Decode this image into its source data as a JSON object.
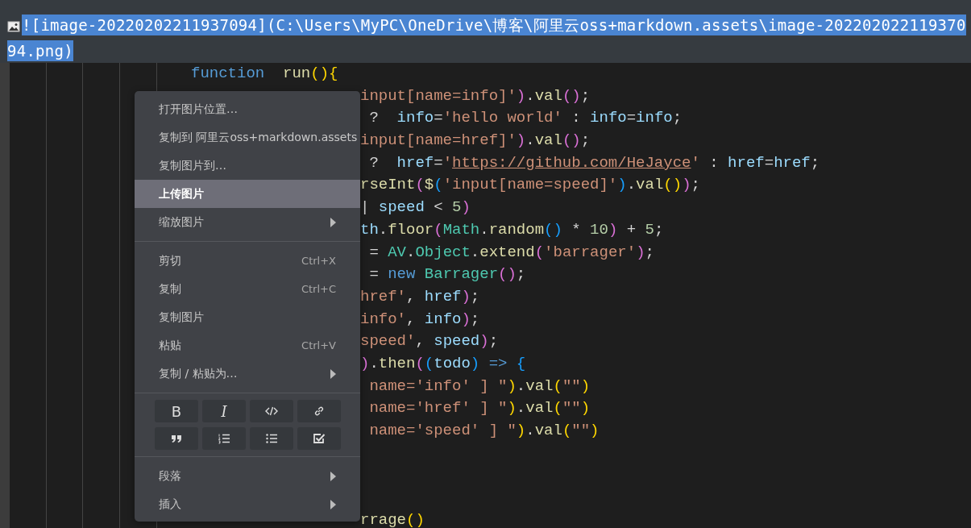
{
  "editor": {
    "image_line": {
      "text": "![image-20220202211937094](C:\\Users\\MyPC\\OneDrive\\博客\\阿里云oss+markdown.assets\\image-20220202211937094.png)",
      "selected": true
    },
    "code_lines": [
      {
        "kind": "full",
        "tokens": [
          {
            "text": "function",
            "kind": "kw"
          },
          {
            "text": "  run",
            "kind": "fn"
          },
          {
            "text": "(){",
            "kind": "br1"
          }
        ]
      },
      {
        "kind": "clipped",
        "tokens": [
          {
            "text": "input[name=info]'",
            "kind": "str"
          },
          {
            "text": ")",
            "kind": "br2"
          },
          {
            "text": ".",
            "kind": "op"
          },
          {
            "text": "val",
            "kind": "fn"
          },
          {
            "text": "()",
            "kind": "br2"
          },
          {
            "text": ";",
            "kind": "op"
          }
        ]
      },
      {
        "kind": "clipped",
        "tokens": [
          {
            "text": " ?  ",
            "kind": "op"
          },
          {
            "text": "info",
            "kind": "var"
          },
          {
            "text": "=",
            "kind": "op"
          },
          {
            "text": "'hello world'",
            "kind": "str"
          },
          {
            "text": " : ",
            "kind": "op"
          },
          {
            "text": "info",
            "kind": "var"
          },
          {
            "text": "=",
            "kind": "op"
          },
          {
            "text": "info",
            "kind": "var"
          },
          {
            "text": ";",
            "kind": "op"
          }
        ]
      },
      {
        "kind": "clipped",
        "tokens": [
          {
            "text": "input[name=href]'",
            "kind": "str"
          },
          {
            "text": ")",
            "kind": "br2"
          },
          {
            "text": ".",
            "kind": "op"
          },
          {
            "text": "val",
            "kind": "fn"
          },
          {
            "text": "()",
            "kind": "br2"
          },
          {
            "text": ";",
            "kind": "op"
          }
        ]
      },
      {
        "kind": "clipped",
        "tokens": [
          {
            "text": " ?  ",
            "kind": "op"
          },
          {
            "text": "href",
            "kind": "var"
          },
          {
            "text": "=",
            "kind": "op"
          },
          {
            "text": "'",
            "kind": "str"
          },
          {
            "text": "https://github.com/HeJayce",
            "kind": "link"
          },
          {
            "text": "'",
            "kind": "str"
          },
          {
            "text": " : ",
            "kind": "op"
          },
          {
            "text": "href",
            "kind": "var"
          },
          {
            "text": "=",
            "kind": "op"
          },
          {
            "text": "href",
            "kind": "var"
          },
          {
            "text": ";",
            "kind": "op"
          }
        ]
      },
      {
        "kind": "clipped",
        "tokens": [
          {
            "text": "rseInt",
            "kind": "fn"
          },
          {
            "text": "(",
            "kind": "br2"
          },
          {
            "text": "$",
            "kind": "fn"
          },
          {
            "text": "(",
            "kind": "br3"
          },
          {
            "text": "'input[name=speed]'",
            "kind": "str"
          },
          {
            "text": ")",
            "kind": "br3"
          },
          {
            "text": ".",
            "kind": "op"
          },
          {
            "text": "val",
            "kind": "fn"
          },
          {
            "text": "()",
            "kind": "br1"
          },
          {
            "text": ")",
            "kind": "br2"
          },
          {
            "text": ";",
            "kind": "op"
          }
        ]
      },
      {
        "kind": "clipped",
        "tokens": [
          {
            "text": "| ",
            "kind": "op"
          },
          {
            "text": "speed",
            "kind": "var"
          },
          {
            "text": " < ",
            "kind": "op"
          },
          {
            "text": "5",
            "kind": "num"
          },
          {
            "text": ")",
            "kind": "br2"
          }
        ]
      },
      {
        "kind": "clipped",
        "tokens": [
          {
            "text": "th",
            "kind": "var"
          },
          {
            "text": ".",
            "kind": "op"
          },
          {
            "text": "floor",
            "kind": "fn"
          },
          {
            "text": "(",
            "kind": "br2"
          },
          {
            "text": "Math",
            "kind": "cls"
          },
          {
            "text": ".",
            "kind": "op"
          },
          {
            "text": "random",
            "kind": "fn"
          },
          {
            "text": "()",
            "kind": "br3"
          },
          {
            "text": " * ",
            "kind": "op"
          },
          {
            "text": "10",
            "kind": "num"
          },
          {
            "text": ")",
            "kind": "br2"
          },
          {
            "text": " + ",
            "kind": "op"
          },
          {
            "text": "5",
            "kind": "num"
          },
          {
            "text": ";",
            "kind": "op"
          }
        ]
      },
      {
        "kind": "clipped",
        "tokens": [
          {
            "text": " = ",
            "kind": "op"
          },
          {
            "text": "AV",
            "kind": "cls"
          },
          {
            "text": ".",
            "kind": "op"
          },
          {
            "text": "Object",
            "kind": "cls"
          },
          {
            "text": ".",
            "kind": "op"
          },
          {
            "text": "extend",
            "kind": "fn"
          },
          {
            "text": "(",
            "kind": "br2"
          },
          {
            "text": "'barrager'",
            "kind": "str"
          },
          {
            "text": ")",
            "kind": "br2"
          },
          {
            "text": ";",
            "kind": "op"
          }
        ]
      },
      {
        "kind": "clipped",
        "tokens": [
          {
            "text": " = ",
            "kind": "op"
          },
          {
            "text": "new ",
            "kind": "kw"
          },
          {
            "text": "Barrager",
            "kind": "cls"
          },
          {
            "text": "()",
            "kind": "br2"
          },
          {
            "text": ";",
            "kind": "op"
          }
        ]
      },
      {
        "kind": "clipped",
        "tokens": [
          {
            "text": "href'",
            "kind": "str"
          },
          {
            "text": ", ",
            "kind": "op"
          },
          {
            "text": "href",
            "kind": "var"
          },
          {
            "text": ")",
            "kind": "br2"
          },
          {
            "text": ";",
            "kind": "op"
          }
        ]
      },
      {
        "kind": "clipped",
        "tokens": [
          {
            "text": "info'",
            "kind": "str"
          },
          {
            "text": ", ",
            "kind": "op"
          },
          {
            "text": "info",
            "kind": "var"
          },
          {
            "text": ")",
            "kind": "br2"
          },
          {
            "text": ";",
            "kind": "op"
          }
        ]
      },
      {
        "kind": "clipped",
        "tokens": [
          {
            "text": "speed'",
            "kind": "str"
          },
          {
            "text": ", ",
            "kind": "op"
          },
          {
            "text": "speed",
            "kind": "var"
          },
          {
            "text": ")",
            "kind": "br2"
          },
          {
            "text": ";",
            "kind": "op"
          }
        ]
      },
      {
        "kind": "clipped",
        "tokens": [
          {
            "text": ")",
            "kind": "br2"
          },
          {
            "text": ".",
            "kind": "op"
          },
          {
            "text": "then",
            "kind": "fn"
          },
          {
            "text": "(",
            "kind": "br2"
          },
          {
            "text": "(",
            "kind": "br3"
          },
          {
            "text": "todo",
            "kind": "var"
          },
          {
            "text": ")",
            "kind": "br3"
          },
          {
            "text": " => ",
            "kind": "kw"
          },
          {
            "text": "{",
            "kind": "br3"
          }
        ]
      },
      {
        "kind": "clipped",
        "tokens": [
          {
            "text": " name='info' ] \"",
            "kind": "str"
          },
          {
            "text": ")",
            "kind": "br1"
          },
          {
            "text": ".",
            "kind": "op"
          },
          {
            "text": "val",
            "kind": "fn"
          },
          {
            "text": "(",
            "kind": "br1"
          },
          {
            "text": "\"\"",
            "kind": "str"
          },
          {
            "text": ")",
            "kind": "br1"
          }
        ]
      },
      {
        "kind": "clipped",
        "tokens": [
          {
            "text": " name='href' ] \"",
            "kind": "str"
          },
          {
            "text": ")",
            "kind": "br1"
          },
          {
            "text": ".",
            "kind": "op"
          },
          {
            "text": "val",
            "kind": "fn"
          },
          {
            "text": "(",
            "kind": "br1"
          },
          {
            "text": "\"\"",
            "kind": "str"
          },
          {
            "text": ")",
            "kind": "br1"
          }
        ]
      },
      {
        "kind": "clipped",
        "tokens": [
          {
            "text": " name='speed' ] \"",
            "kind": "str"
          },
          {
            "text": ")",
            "kind": "br1"
          },
          {
            "text": ".",
            "kind": "op"
          },
          {
            "text": "val",
            "kind": "fn"
          },
          {
            "text": "(",
            "kind": "br1"
          },
          {
            "text": "\"\"",
            "kind": "str"
          },
          {
            "text": ")",
            "kind": "br1"
          }
        ]
      },
      {
        "kind": "blank"
      },
      {
        "kind": "blank"
      },
      {
        "kind": "blank"
      },
      {
        "kind": "clipped",
        "tokens": [
          {
            "text": "rrage",
            "kind": "fn"
          },
          {
            "text": "()",
            "kind": "br1"
          }
        ]
      }
    ]
  },
  "context_menu": {
    "groups": [
      {
        "kind": "items",
        "items": [
          {
            "label": "打开图片位置…",
            "submenu": false,
            "selected": false
          },
          {
            "label": "复制到 阿里云oss+markdown.assets",
            "submenu": false,
            "selected": false
          },
          {
            "label": "复制图片到…",
            "submenu": false,
            "selected": false
          },
          {
            "label": "上传图片",
            "submenu": false,
            "selected": true
          },
          {
            "label": "缩放图片",
            "submenu": true,
            "selected": false
          }
        ]
      },
      {
        "kind": "items",
        "items": [
          {
            "label": "剪切",
            "shortcut": "Ctrl+X",
            "submenu": false,
            "selected": false
          },
          {
            "label": "复制",
            "shortcut": "Ctrl+C",
            "submenu": false,
            "selected": false
          },
          {
            "label": "复制图片",
            "submenu": false,
            "selected": false
          },
          {
            "label": "粘贴",
            "shortcut": "Ctrl+V",
            "submenu": false,
            "selected": false
          },
          {
            "label": "复制 / 粘贴为…",
            "submenu": true,
            "selected": false
          }
        ]
      },
      {
        "kind": "format",
        "buttons": [
          {
            "kind": "bold",
            "label": "B"
          },
          {
            "kind": "italic",
            "label": "I"
          },
          {
            "kind": "code"
          },
          {
            "kind": "link"
          },
          {
            "kind": "quote"
          },
          {
            "kind": "ordered-list"
          },
          {
            "kind": "bullet-list"
          },
          {
            "kind": "task-list"
          }
        ]
      },
      {
        "kind": "items",
        "items": [
          {
            "label": "段落",
            "submenu": true,
            "selected": false
          },
          {
            "label": "插入",
            "submenu": true,
            "selected": false
          }
        ]
      }
    ]
  }
}
